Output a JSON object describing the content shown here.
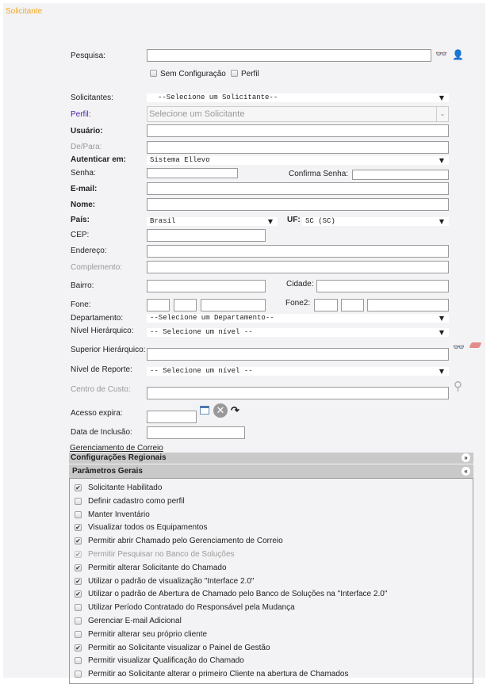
{
  "title": "Solicitante",
  "colors": {
    "title": "#f5a623",
    "perfil_label": "#4b1fa8"
  },
  "search": {
    "label": "Pesquisa:",
    "value": "",
    "sem_config": "Sem Configuração",
    "perfil": "Perfil"
  },
  "form": {
    "solicitantes_label": "Solicitantes:",
    "solicitantes_value": "--Selecione um Solicitante--",
    "perfil_label": "Perfil:",
    "perfil_value": "Selecione um Solicitante",
    "usuario_label": "Usuário:",
    "depara_label": "De/Para:",
    "autenticar_label": "Autenticar em:",
    "autenticar_value": "Sistema Ellevo",
    "senha_label": "Senha:",
    "confirma_label": "Confirma Senha:",
    "email_label": "E-mail:",
    "nome_label": "Nome:",
    "pais_label": "País:",
    "pais_value": "Brasil",
    "uf_label": "UF:",
    "uf_value": "SC (SC)",
    "cep_label": "CEP:",
    "endereco_label": "Endereço:",
    "complemento_label": "Complemento:",
    "bairro_label": "Bairro:",
    "cidade_label": "Cidade:",
    "fone_label": "Fone:",
    "fone2_label": "Fone2:",
    "departamento_label": "Departamento:",
    "departamento_value": "--Selecione um Departamento--",
    "nivel_label": "Nível Hierárquico:",
    "nivel_value": "-- Selecione um nível --",
    "superior_label": "Superior Hierárquico:",
    "reporte_label": "Nível de Reporte:",
    "reporte_value": "-- Selecione um nível --",
    "centro_label": "Centro de Custo:",
    "acesso_label": "Acesso expira:",
    "inclusao_label": "Data de Inclusão:"
  },
  "link_correio": "Gerenciamento de Correio",
  "sections": {
    "regionais": "Configurações Regionais",
    "gerais": "Parâmetros Gerais"
  },
  "params": [
    {
      "label": "Solicitante Habilitado",
      "checked": true,
      "disabled": false
    },
    {
      "label": "Definir cadastro como perfil",
      "checked": false,
      "disabled": false
    },
    {
      "label": "Manter Inventário",
      "checked": false,
      "disabled": false
    },
    {
      "label": "Visualizar todos os Equipamentos",
      "checked": true,
      "disabled": false
    },
    {
      "label": "Permitir abrir Chamado pelo Gerenciamento de Correio",
      "checked": true,
      "disabled": false
    },
    {
      "label": "Permitir Pesquisar no Banco de Soluções",
      "checked": true,
      "disabled": true
    },
    {
      "label": "Permitir alterar Solicitante do Chamado",
      "checked": true,
      "disabled": false
    },
    {
      "label": "Utilizar o padrão de visualização \"Interface 2.0\"",
      "checked": true,
      "disabled": false
    },
    {
      "label": "Utilizar o padrão de Abertura de Chamado pelo Banco de Soluções na \"Interface 2.0\"",
      "checked": true,
      "disabled": false
    },
    {
      "label": "Utilizar Período Contratado do Responsável pela Mudança",
      "checked": false,
      "disabled": false
    },
    {
      "label": "Gerenciar E-mail Adicional",
      "checked": false,
      "disabled": false
    },
    {
      "label": "Permitir alterar seu próprio cliente",
      "checked": false,
      "disabled": false
    },
    {
      "label": "Permitir ao Solicitante visualizar o Painel de Gestão",
      "checked": true,
      "disabled": false
    },
    {
      "label": "Permitir visualizar Qualificação do Chamado",
      "checked": false,
      "disabled": false
    },
    {
      "label": "Permitir ao Solicitante alterar o primeiro Cliente na abertura de Chamados",
      "checked": false,
      "disabled": false
    }
  ]
}
